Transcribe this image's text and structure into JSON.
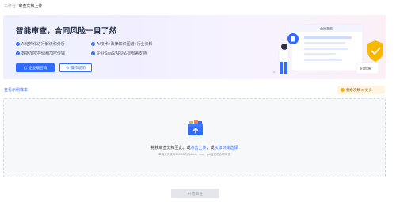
{
  "breadcrumb": {
    "parent": "工作台",
    "separator": "/",
    "current": "审查文档上传"
  },
  "banner": {
    "title": "智能审查，合同风险一目了然",
    "features": [
      "AI结构化进行解读和分析",
      "AI技术+法律知识图谱+行业资料",
      "数据加密存储和加密传输",
      "企业SaaS/API/私有部署支持"
    ],
    "primary_button": "企业版咨询",
    "secondary_button": "操作说明",
    "illustration": {
      "card_title": "合同条款",
      "badge_text": "审查结果"
    }
  },
  "link_example": "查看示例样本",
  "quota": {
    "label": "剩余次数 0",
    "sub": "更多"
  },
  "upload": {
    "main_prefix": "拖拽审查文档至此，或",
    "link_upload": "点击上传",
    "main_mid": "，或",
    "link_kb": "从知识库选择",
    "sub": "单篇文件支持100MB内的docx、doc、pdf格式的合同审查"
  },
  "start_button": "开始审查",
  "colors": {
    "accent": "#2f6bff",
    "quota_bg": "#fff4e0"
  }
}
